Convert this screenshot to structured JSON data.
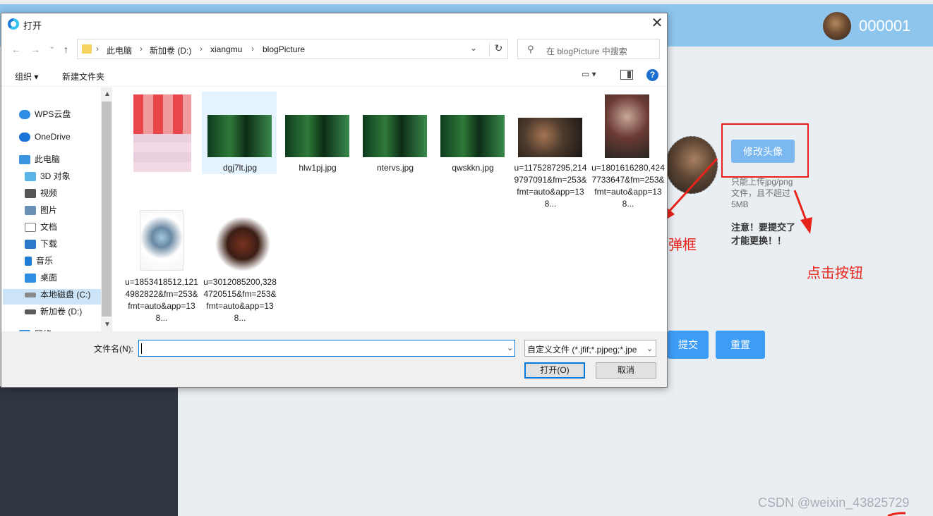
{
  "app": {
    "username": "000001",
    "change_avatar_label": "修改头像",
    "upload_tip": "只能上传jpg/png文件，且不超过5MB",
    "note": "注意！要提交了才能更换！！",
    "popup_annotation": "出现弹框",
    "click_annotation": "点击按钮",
    "submit_label": "提交",
    "reset_label": "重置",
    "watermark": "CSDN @weixin_43825729",
    "annotation_color": "#e8231b",
    "header_color": "#8ec5ec",
    "button_color": "#3d9cf5"
  },
  "dialog": {
    "title": "打开",
    "close": "✕",
    "nav": {
      "back": "←",
      "forward": "→",
      "recent": "⌄",
      "up": "↑"
    },
    "breadcrumb": [
      "此电脑",
      "新加卷 (D:)",
      "xiangmu",
      "blogPicture"
    ],
    "search_placeholder": "在 blogPicture 中搜索",
    "toolbar": {
      "organize": "组织 ▾",
      "new_folder": "新建文件夹",
      "help": "?"
    },
    "sidebar": [
      {
        "label": "WPS云盘",
        "icon": "cloud-icon"
      },
      {
        "label": "OneDrive",
        "icon": "onedrive-icon"
      },
      {
        "label": "此电脑",
        "icon": "computer-icon"
      },
      {
        "label": "3D 对象",
        "icon": "3d-objects-icon"
      },
      {
        "label": "视频",
        "icon": "video-icon"
      },
      {
        "label": "图片",
        "icon": "pictures-icon"
      },
      {
        "label": "文档",
        "icon": "documents-icon"
      },
      {
        "label": "下载",
        "icon": "download-icon"
      },
      {
        "label": "音乐",
        "icon": "music-icon"
      },
      {
        "label": "桌面",
        "icon": "desktop-icon"
      },
      {
        "label": "本地磁盘 (C:)",
        "icon": "drive-icon"
      },
      {
        "label": "新加卷 (D:)",
        "icon": "drive-icon"
      },
      {
        "label": "网络",
        "icon": "network-icon"
      }
    ],
    "files": [
      {
        "name": "",
        "kind": "blurred"
      },
      {
        "name": "dgj7lt.jpg",
        "kind": "bird"
      },
      {
        "name": "hlw1pj.jpg",
        "kind": "bird"
      },
      {
        "name": "ntervs.jpg",
        "kind": "bird"
      },
      {
        "name": "qwskkn.jpg",
        "kind": "bird"
      },
      {
        "name": "u=1175287295,2149797091&fm=253&fmt=auto&app=138...",
        "kind": "dark"
      },
      {
        "name": "u=1801616280,4247733647&fm=253&fmt=auto&app=138...",
        "kind": "girl"
      },
      {
        "name": "u=1853418512,1214982822&fm=253&fmt=auto&app=138...",
        "kind": "fairy"
      },
      {
        "name": "u=3012085200,3284720515&fm=253&fmt=auto&app=138...",
        "kind": "warrior"
      }
    ],
    "filename_label": "文件名(N):",
    "filename_value": "",
    "filetype": "自定义文件 (*.jfif;*.pjpeg;*.jpe",
    "open_label": "打开(O)",
    "cancel_label": "取消"
  }
}
